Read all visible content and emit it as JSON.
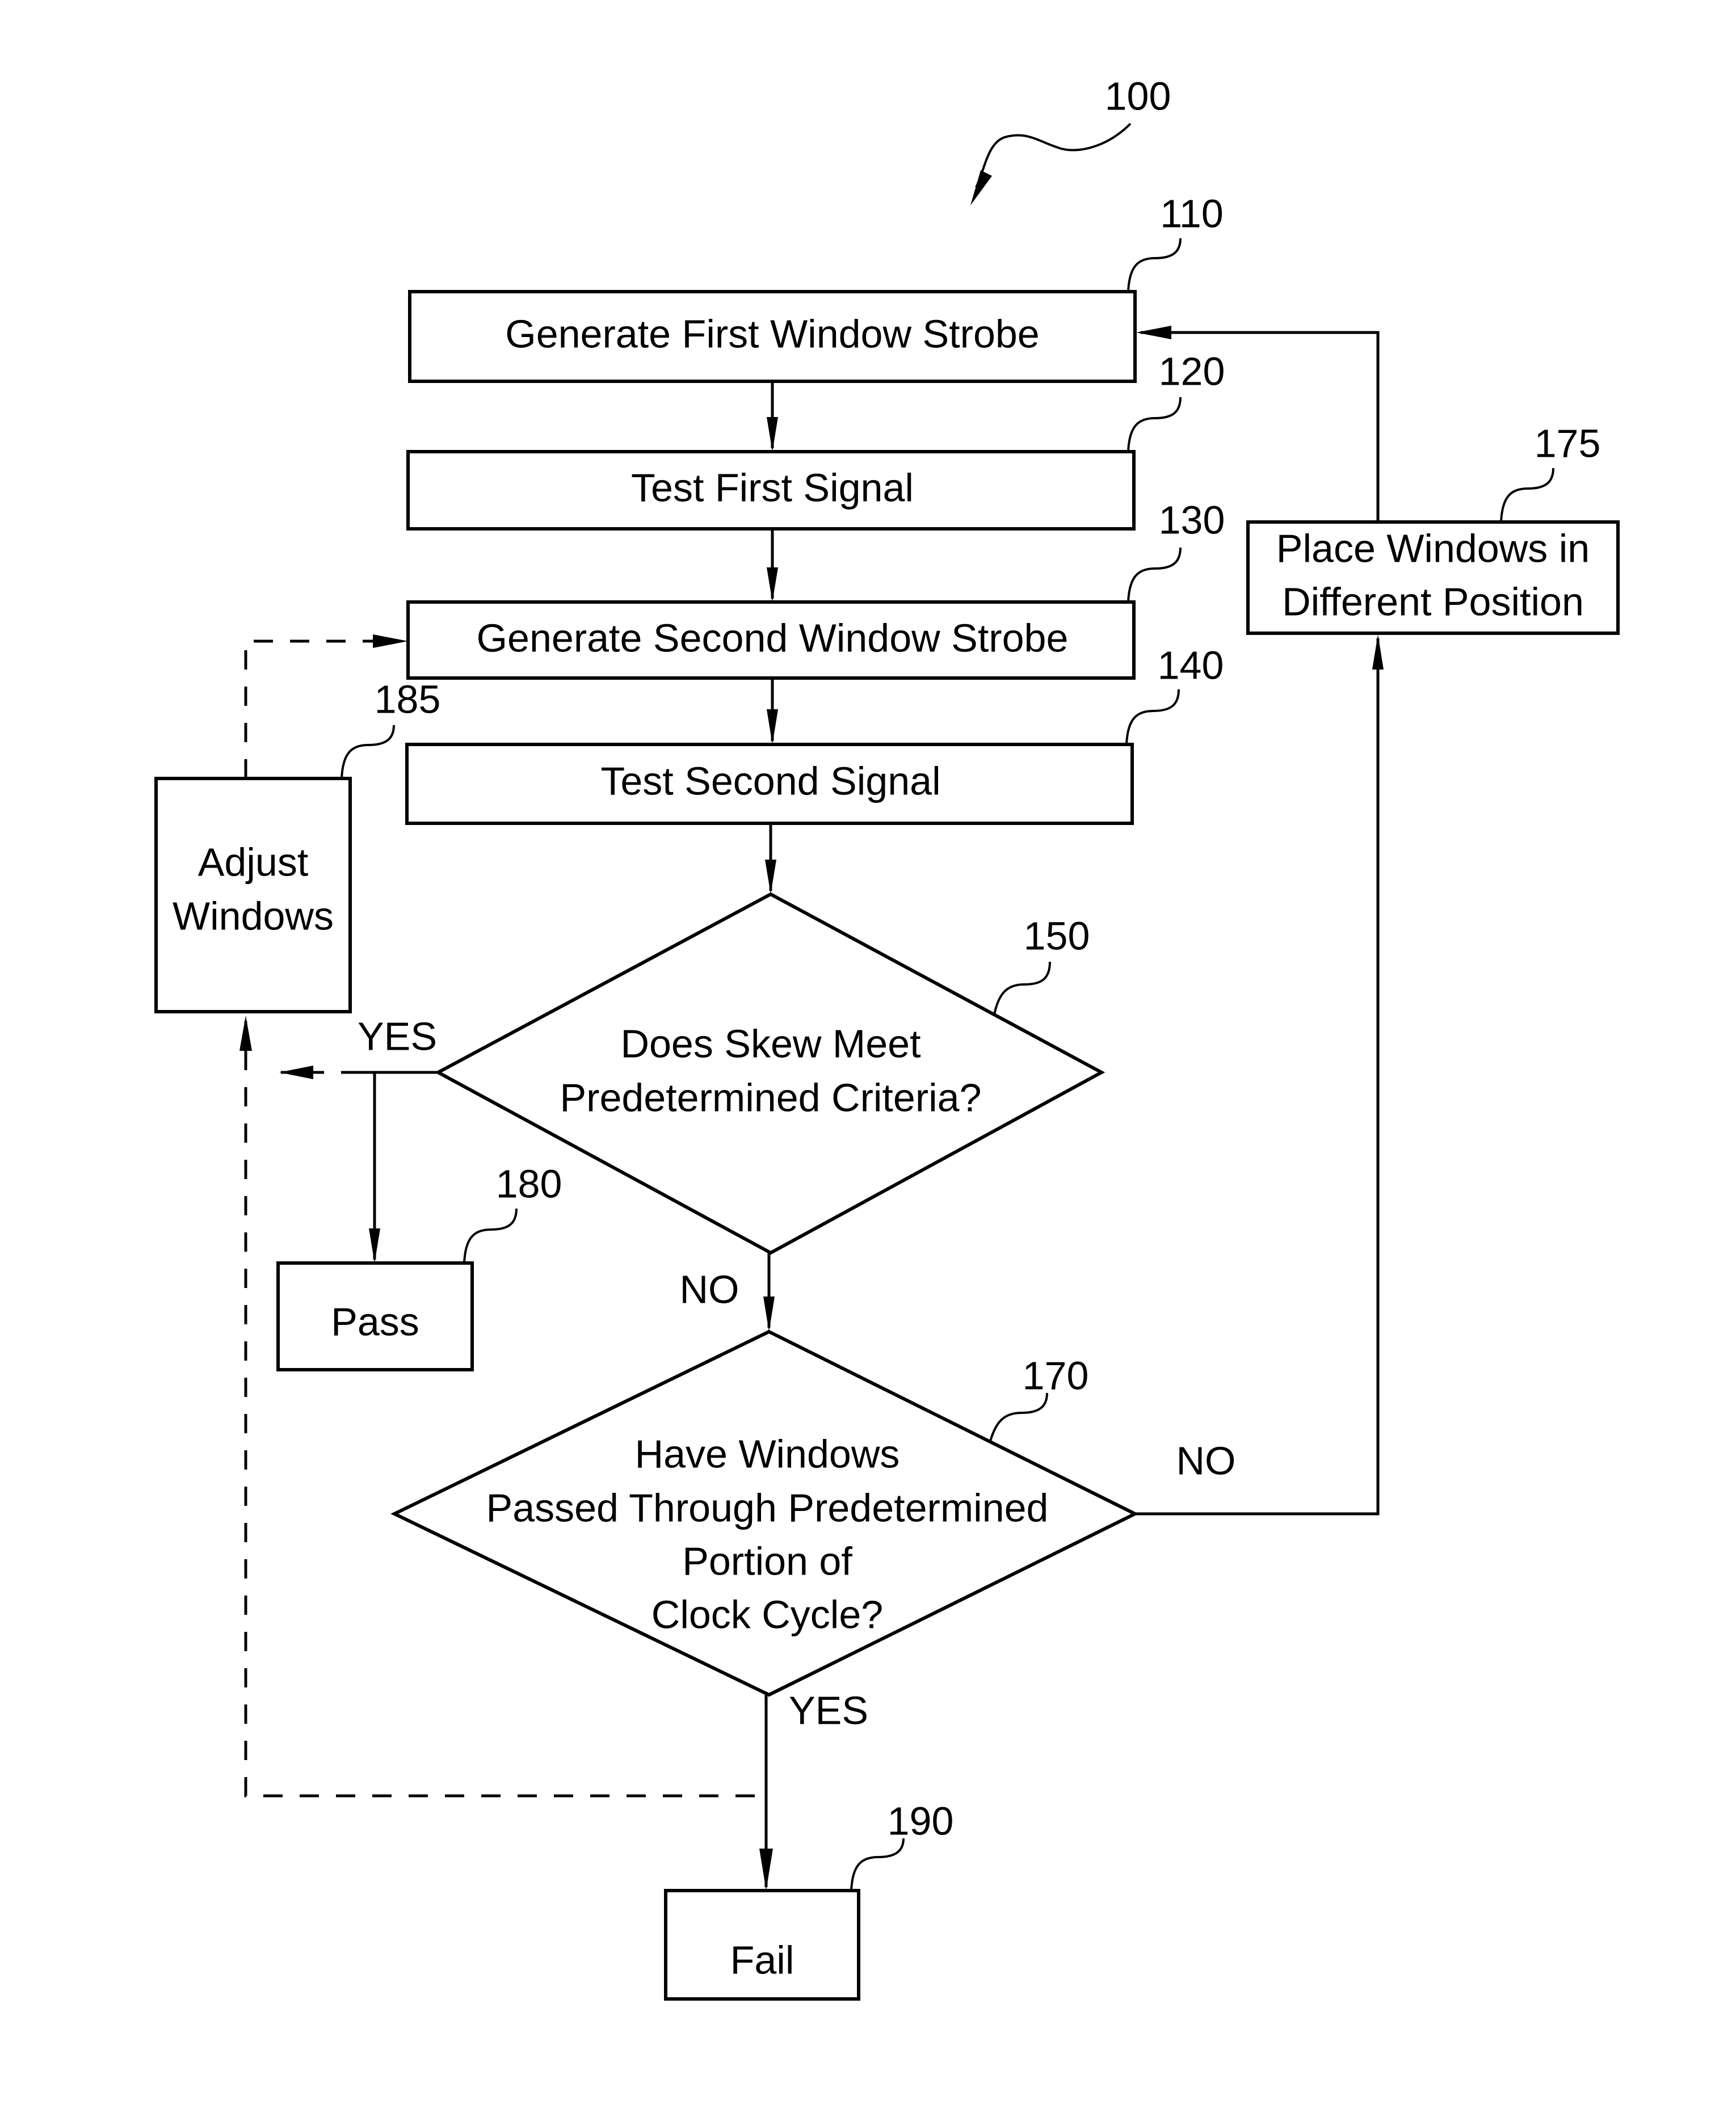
{
  "figure": {
    "ref": "100",
    "steps": {
      "s110": {
        "ref": "110",
        "label": "Generate First Window Strobe"
      },
      "s120": {
        "ref": "120",
        "label": "Test First Signal"
      },
      "s130": {
        "ref": "130",
        "label": "Generate Second Window Strobe"
      },
      "s140": {
        "ref": "140",
        "label": "Test Second Signal"
      },
      "s150": {
        "ref": "150",
        "lines": [
          "Does Skew Meet",
          "Predetermined Criteria?"
        ]
      },
      "s170": {
        "ref": "170",
        "lines": [
          "Have Windows",
          "Passed Through Predetermined",
          "Portion of",
          "Clock Cycle?"
        ]
      },
      "s175": {
        "ref": "175",
        "lines": [
          "Place Windows in",
          "Different Position"
        ]
      },
      "s180": {
        "ref": "180",
        "label": "Pass"
      },
      "s185": {
        "ref": "185",
        "lines": [
          "Adjust",
          "Windows"
        ]
      },
      "s190": {
        "ref": "190",
        "label": "Fail"
      }
    },
    "branch_labels": {
      "s150_yes": "YES",
      "s150_no": "NO",
      "s170_no": "NO",
      "s170_yes": "YES"
    }
  }
}
